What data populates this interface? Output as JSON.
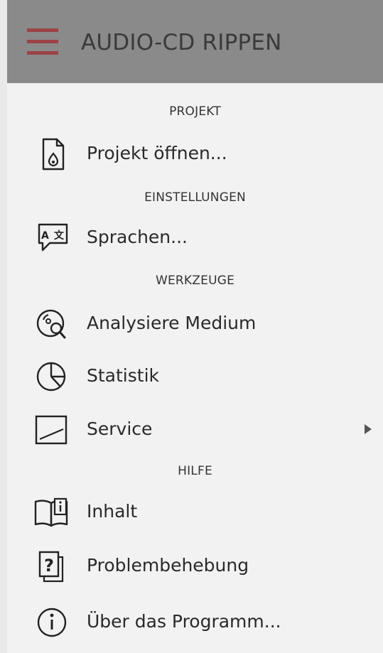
{
  "header": {
    "title": "AUDIO-CD RIPPEN",
    "menu_icon": "hamburger-icon",
    "accent_color": "#9b4248"
  },
  "sections": {
    "projekt": {
      "label": "PROJEKT",
      "items": [
        {
          "label": "Projekt öffnen...",
          "icon": "open-project-document-icon"
        }
      ]
    },
    "einstellungen": {
      "label": "EINSTELLUNGEN",
      "items": [
        {
          "label": "Sprachen...",
          "icon": "language-speech-bubble-icon"
        }
      ]
    },
    "werkzeuge": {
      "label": "WERKZEUGE",
      "items": [
        {
          "label": "Analysiere Medium",
          "icon": "analyze-disc-magnifier-icon"
        },
        {
          "label": "Statistik",
          "icon": "pie-chart-icon"
        },
        {
          "label": "Service",
          "icon": "service-box-icon",
          "has_submenu": true
        }
      ]
    },
    "hilfe": {
      "label": "HILFE",
      "items": [
        {
          "label": "Inhalt",
          "icon": "book-info-icon"
        },
        {
          "label": "Problembehebung",
          "icon": "question-pages-icon"
        },
        {
          "label": "Über das Programm...",
          "icon": "info-circle-icon"
        }
      ]
    }
  }
}
